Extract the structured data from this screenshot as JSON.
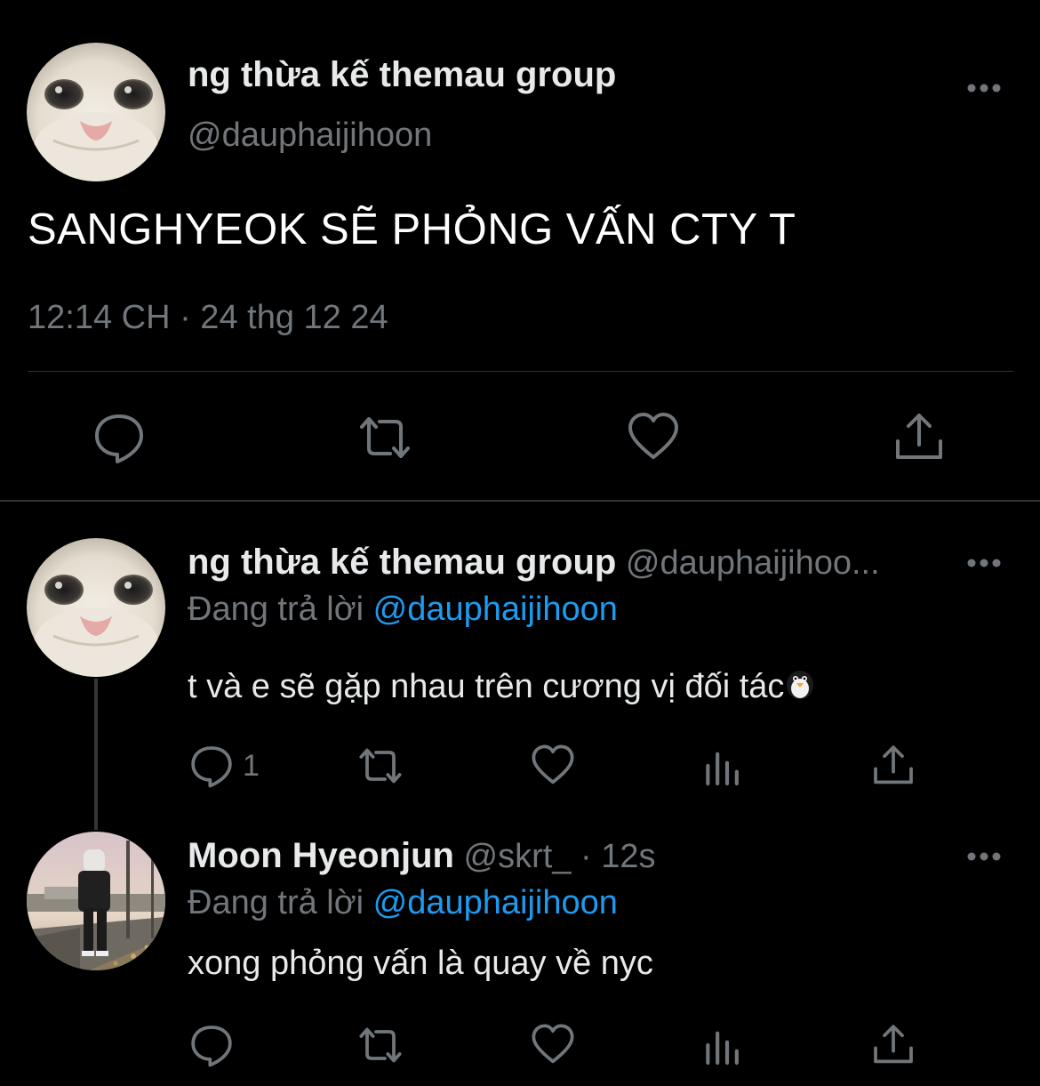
{
  "main_tweet": {
    "display_name": "ng thừa kế themau group",
    "handle": "@dauphaijihoon",
    "text": "SANGHYEOK SẼ PHỎNG VẤN CTY T",
    "timestamp": "12:14 CH · 24 thg 12 24",
    "avatar_icon": "cat-face-avatar",
    "actions": [
      "reply-icon",
      "retweet-icon",
      "like-icon",
      "share-icon"
    ]
  },
  "replies": [
    {
      "display_name": "ng thừa kế themau group",
      "handle_meta": "@dauphaijihoo...",
      "replying_label": "Đang trả lời",
      "replying_to": "@dauphaijihoon",
      "text": "t và e sẽ gặp nhau trên cương vị đối tác",
      "emoji": "penguin-emoji",
      "reply_count": "1",
      "avatar_icon": "cat-face-avatar"
    },
    {
      "display_name": "Moon Hyeonjun",
      "handle_meta": "@skrt_ · 12s",
      "replying_label": "Đang trả lời",
      "replying_to": "@dauphaijihoon",
      "text": "xong phỏng vấn là quay về nyc",
      "reply_count": "",
      "avatar_icon": "street-photo-avatar"
    }
  ],
  "colors": {
    "background": "#000000",
    "primary_text": "#e7e9ea",
    "secondary_text": "#71767b",
    "link": "#1d9bf0",
    "divider": "#2f3336"
  }
}
